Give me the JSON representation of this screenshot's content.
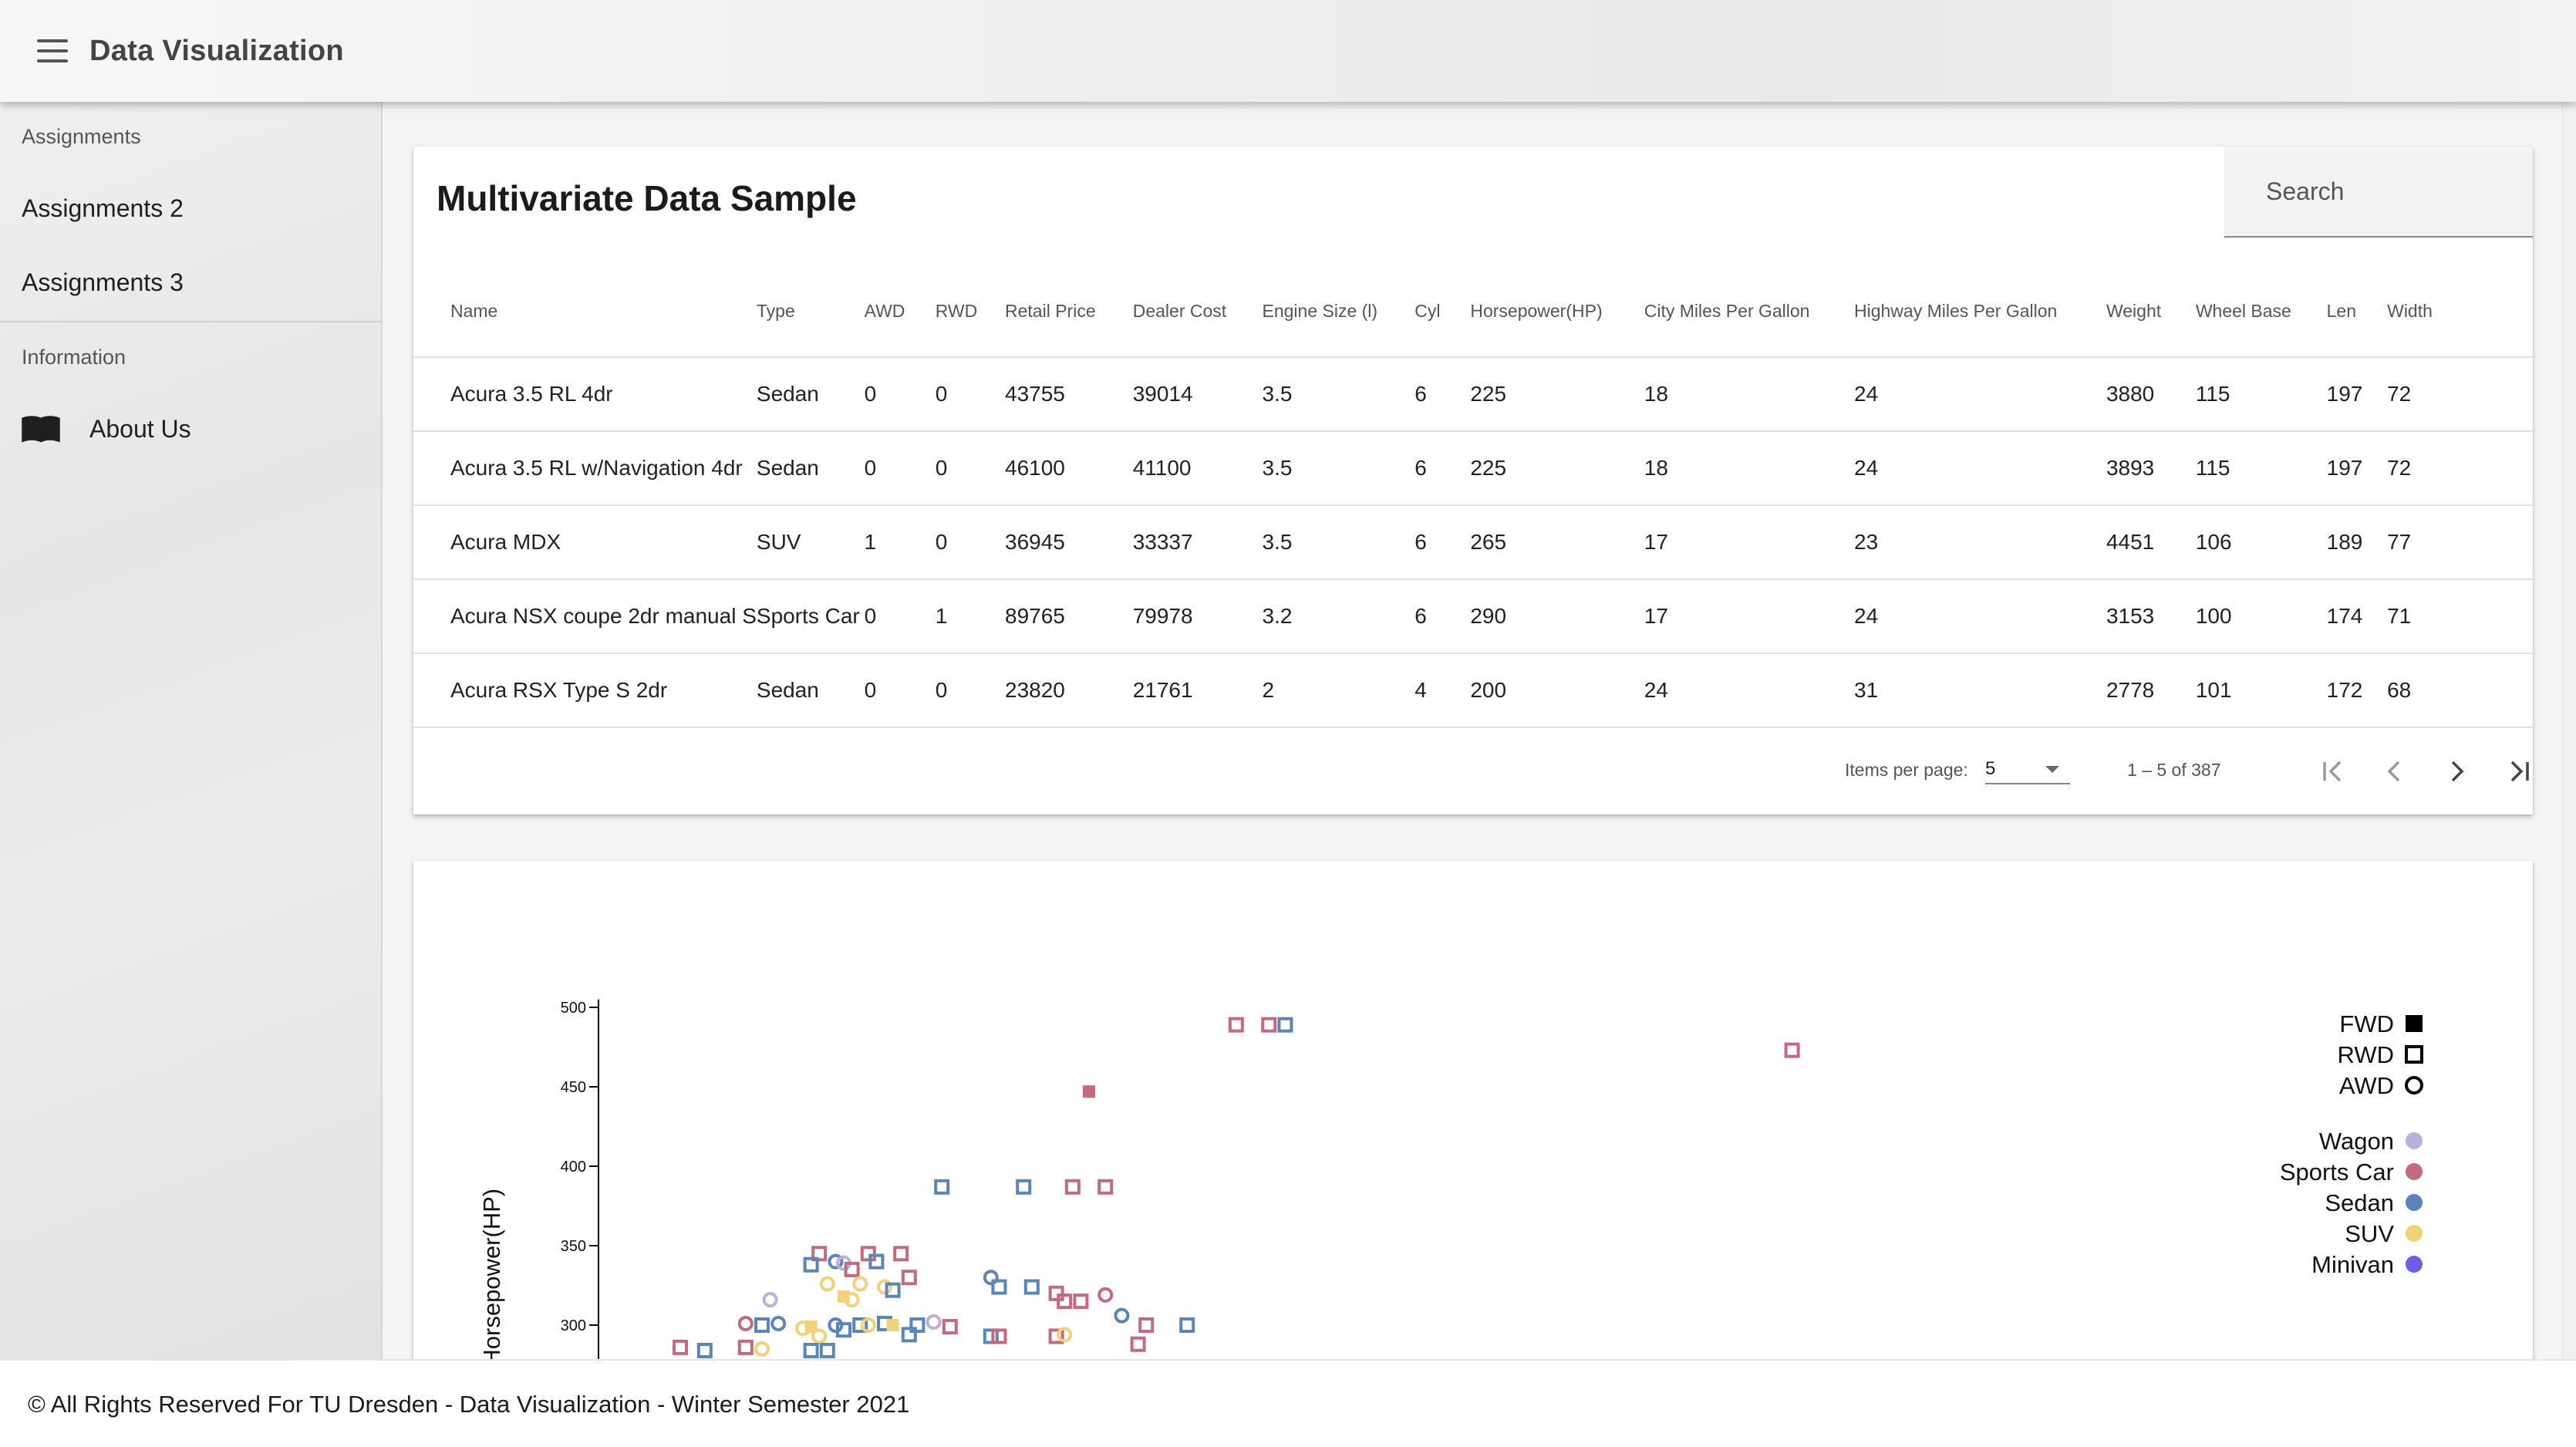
{
  "app": {
    "title": "Data Visualization"
  },
  "sidebar": {
    "sections": [
      {
        "label": "Assignments",
        "items": [
          "Assignments 2",
          "Assignments 3"
        ]
      },
      {
        "label": "Information",
        "items": [
          "About Us"
        ]
      }
    ]
  },
  "table_card": {
    "title": "Multivariate Data Sample",
    "search_placeholder": "Search",
    "columns": [
      "Name",
      "Type",
      "AWD",
      "RWD",
      "Retail Price",
      "Dealer Cost",
      "Engine Size (l)",
      "Cyl",
      "Horsepower(HP)",
      "City Miles Per Gallon",
      "Highway Miles Per Gallon",
      "Weight",
      "Wheel Base",
      "Len",
      "Width"
    ],
    "rows": [
      [
        "Acura 3.5 RL 4dr",
        "Sedan",
        "0",
        "0",
        "43755",
        "39014",
        "3.5",
        "6",
        "225",
        "18",
        "24",
        "3880",
        "115",
        "197",
        "72"
      ],
      [
        "Acura 3.5 RL w/Navigation 4dr",
        "Sedan",
        "0",
        "0",
        "46100",
        "41100",
        "3.5",
        "6",
        "225",
        "18",
        "24",
        "3893",
        "115",
        "197",
        "72"
      ],
      [
        "Acura MDX",
        "SUV",
        "1",
        "0",
        "36945",
        "33337",
        "3.5",
        "6",
        "265",
        "17",
        "23",
        "4451",
        "106",
        "189",
        "77"
      ],
      [
        "Acura NSX coupe 2dr manual S",
        "Sports Car",
        "0",
        "1",
        "89765",
        "79978",
        "3.2",
        "6",
        "290",
        "17",
        "24",
        "3153",
        "100",
        "174",
        "71"
      ],
      [
        "Acura RSX Type S 2dr",
        "Sedan",
        "0",
        "0",
        "23820",
        "21761",
        "2",
        "4",
        "200",
        "24",
        "31",
        "2778",
        "101",
        "172",
        "68"
      ]
    ],
    "paginator": {
      "items_per_page_label": "Items per page:",
      "items_per_page": "5",
      "range_label": "1 – 5 of 387"
    }
  },
  "chart_data": {
    "type": "scatter",
    "ylabel": "Horsepower(HP)",
    "ylim": [
      280,
      500
    ],
    "y_ticks": [
      "500",
      "450",
      "400",
      "350",
      "300"
    ],
    "legend_placement": "top-right",
    "shape_legend": [
      {
        "label": "FWD",
        "shape": "filled-square"
      },
      {
        "label": "RWD",
        "shape": "hollow-square"
      },
      {
        "label": "AWD",
        "shape": "hollow-circle"
      }
    ],
    "type_legend": [
      {
        "label": "Wagon",
        "color": "#b9b1dc"
      },
      {
        "label": "Sports Car",
        "color": "#c5697f"
      },
      {
        "label": "Sedan",
        "color": "#5a85b8"
      },
      {
        "label": "SUV",
        "color": "#f1d27a"
      },
      {
        "label": "Minivan",
        "color": "#6a5fe6"
      }
    ],
    "points": [
      {
        "x": 0.39,
        "y": 489,
        "type": "Sports Car",
        "drive": "RWD"
      },
      {
        "x": 0.41,
        "y": 489,
        "type": "Sports Car",
        "drive": "RWD"
      },
      {
        "x": 0.42,
        "y": 489,
        "type": "Sedan",
        "drive": "RWD"
      },
      {
        "x": 0.73,
        "y": 473,
        "type": "Sports Car",
        "drive": "RWD"
      },
      {
        "x": 0.3,
        "y": 447,
        "type": "Sports Car",
        "drive": "FWD"
      },
      {
        "x": 0.21,
        "y": 387,
        "type": "Sedan",
        "drive": "RWD"
      },
      {
        "x": 0.26,
        "y": 387,
        "type": "Sedan",
        "drive": "RWD"
      },
      {
        "x": 0.29,
        "y": 387,
        "type": "Sports Car",
        "drive": "RWD"
      },
      {
        "x": 0.31,
        "y": 387,
        "type": "Sports Car",
        "drive": "RWD"
      },
      {
        "x": 0.135,
        "y": 345,
        "type": "Sports Car",
        "drive": "RWD"
      },
      {
        "x": 0.13,
        "y": 338,
        "type": "Sedan",
        "drive": "RWD"
      },
      {
        "x": 0.145,
        "y": 340,
        "type": "Sedan",
        "drive": "AWD"
      },
      {
        "x": 0.15,
        "y": 339,
        "type": "Wagon",
        "drive": "AWD"
      },
      {
        "x": 0.155,
        "y": 335,
        "type": "Sports Car",
        "drive": "RWD"
      },
      {
        "x": 0.165,
        "y": 345,
        "type": "Sports Car",
        "drive": "RWD"
      },
      {
        "x": 0.17,
        "y": 340,
        "type": "Sedan",
        "drive": "RWD"
      },
      {
        "x": 0.185,
        "y": 345,
        "type": "Sports Car",
        "drive": "RWD"
      },
      {
        "x": 0.19,
        "y": 330,
        "type": "Sports Car",
        "drive": "RWD"
      },
      {
        "x": 0.14,
        "y": 326,
        "type": "SUV",
        "drive": "AWD"
      },
      {
        "x": 0.16,
        "y": 326,
        "type": "SUV",
        "drive": "AWD"
      },
      {
        "x": 0.15,
        "y": 318,
        "type": "SUV",
        "drive": "FWD"
      },
      {
        "x": 0.155,
        "y": 316,
        "type": "SUV",
        "drive": "AWD"
      },
      {
        "x": 0.175,
        "y": 324,
        "type": "SUV",
        "drive": "AWD"
      },
      {
        "x": 0.18,
        "y": 322,
        "type": "Sedan",
        "drive": "RWD"
      },
      {
        "x": 0.105,
        "y": 316,
        "type": "Wagon",
        "drive": "AWD"
      },
      {
        "x": 0.09,
        "y": 301,
        "type": "Sports Car",
        "drive": "AWD"
      },
      {
        "x": 0.1,
        "y": 300,
        "type": "Sedan",
        "drive": "RWD"
      },
      {
        "x": 0.11,
        "y": 301,
        "type": "Sedan",
        "drive": "AWD"
      },
      {
        "x": 0.125,
        "y": 298,
        "type": "SUV",
        "drive": "AWD"
      },
      {
        "x": 0.13,
        "y": 299,
        "type": "SUV",
        "drive": "FWD"
      },
      {
        "x": 0.145,
        "y": 300,
        "type": "Sedan",
        "drive": "AWD"
      },
      {
        "x": 0.15,
        "y": 297,
        "type": "Sedan",
        "drive": "RWD"
      },
      {
        "x": 0.16,
        "y": 300,
        "type": "Sedan",
        "drive": "RWD"
      },
      {
        "x": 0.165,
        "y": 300,
        "type": "SUV",
        "drive": "AWD"
      },
      {
        "x": 0.175,
        "y": 301,
        "type": "Sedan",
        "drive": "RWD"
      },
      {
        "x": 0.18,
        "y": 300,
        "type": "SUV",
        "drive": "FWD"
      },
      {
        "x": 0.195,
        "y": 300,
        "type": "Sedan",
        "drive": "RWD"
      },
      {
        "x": 0.205,
        "y": 302,
        "type": "Wagon",
        "drive": "AWD"
      },
      {
        "x": 0.215,
        "y": 299,
        "type": "Sports Car",
        "drive": "RWD"
      },
      {
        "x": 0.19,
        "y": 294,
        "type": "Sedan",
        "drive": "RWD"
      },
      {
        "x": 0.135,
        "y": 293,
        "type": "SUV",
        "drive": "AWD"
      },
      {
        "x": 0.24,
        "y": 330,
        "type": "Sedan",
        "drive": "AWD"
      },
      {
        "x": 0.245,
        "y": 324,
        "type": "Sedan",
        "drive": "RWD"
      },
      {
        "x": 0.265,
        "y": 324,
        "type": "Sedan",
        "drive": "RWD"
      },
      {
        "x": 0.28,
        "y": 320,
        "type": "Sports Car",
        "drive": "RWD"
      },
      {
        "x": 0.285,
        "y": 315,
        "type": "Sports Car",
        "drive": "RWD"
      },
      {
        "x": 0.295,
        "y": 315,
        "type": "Sports Car",
        "drive": "RWD"
      },
      {
        "x": 0.31,
        "y": 319,
        "type": "Sports Car",
        "drive": "AWD"
      },
      {
        "x": 0.32,
        "y": 306,
        "type": "Sedan",
        "drive": "AWD"
      },
      {
        "x": 0.335,
        "y": 300,
        "type": "Sports Car",
        "drive": "RWD"
      },
      {
        "x": 0.36,
        "y": 300,
        "type": "Sedan",
        "drive": "RWD"
      },
      {
        "x": 0.24,
        "y": 293,
        "type": "Sedan",
        "drive": "RWD"
      },
      {
        "x": 0.245,
        "y": 293,
        "type": "Sports Car",
        "drive": "RWD"
      },
      {
        "x": 0.28,
        "y": 293,
        "type": "Sports Car",
        "drive": "RWD"
      },
      {
        "x": 0.285,
        "y": 294,
        "type": "SUV",
        "drive": "AWD"
      },
      {
        "x": 0.33,
        "y": 288,
        "type": "Sports Car",
        "drive": "RWD"
      },
      {
        "x": 0.05,
        "y": 286,
        "type": "Sports Car",
        "drive": "RWD"
      },
      {
        "x": 0.065,
        "y": 284,
        "type": "Sedan",
        "drive": "RWD"
      },
      {
        "x": 0.09,
        "y": 286,
        "type": "Sports Car",
        "drive": "RWD"
      },
      {
        "x": 0.1,
        "y": 285,
        "type": "SUV",
        "drive": "AWD"
      },
      {
        "x": 0.13,
        "y": 284,
        "type": "Sedan",
        "drive": "RWD"
      },
      {
        "x": 0.14,
        "y": 284,
        "type": "Sedan",
        "drive": "RWD"
      }
    ]
  },
  "footer": {
    "text": "© All Rights Reserved For TU Dresden - Data Visualization - Winter Semester 2021"
  }
}
